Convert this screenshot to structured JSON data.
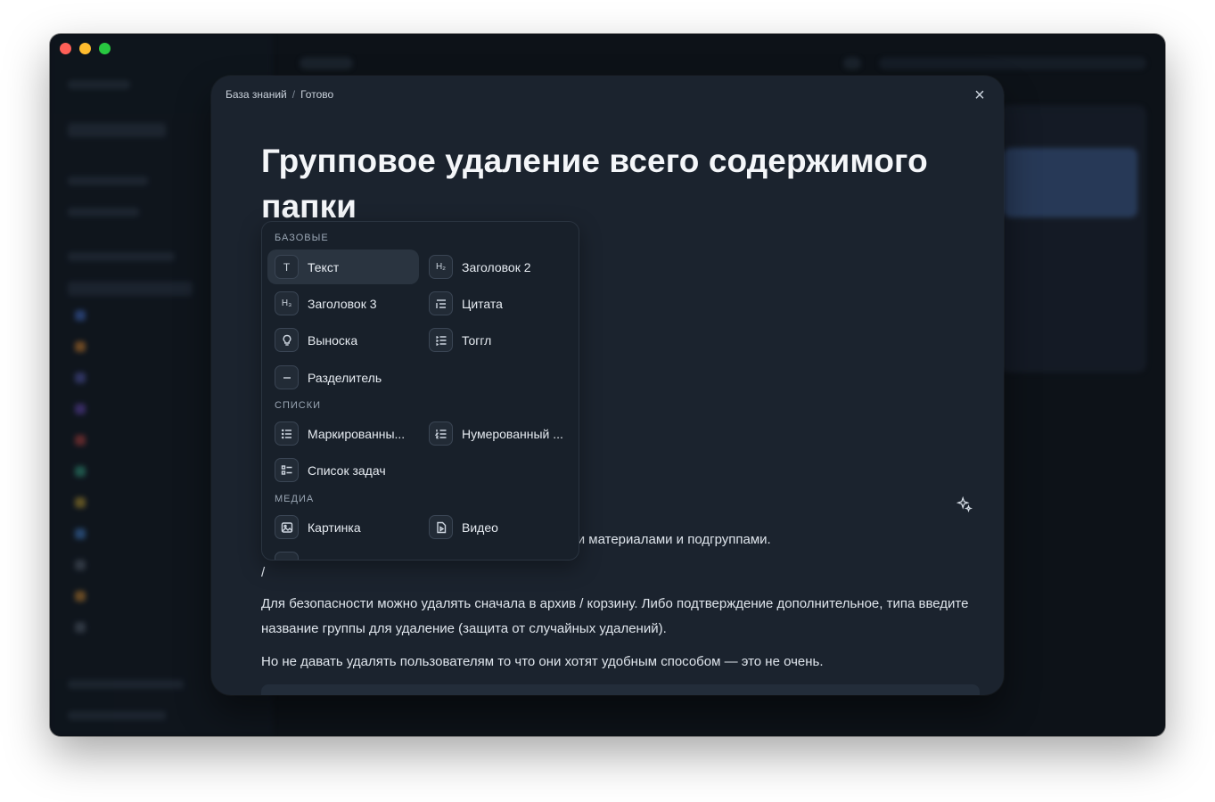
{
  "modal": {
    "breadcrumb": [
      "База знаний",
      "Готово"
    ],
    "breadcrumb_separator": "/",
    "close_label": "×",
    "title": "Групповое удаление всего содержимого папки",
    "paragraphs": {
      "partial": "ли материалами и подгруппами.",
      "slash": "/",
      "p2": "Для безопасности можно удалять сначала в архив / корзину. Либо подтверждение дополнительное, типа введите название группы для удаление (защита от случайных удалений).",
      "p3": "Но не давать удалять пользователям то что они хотят удобным способом — это не очень."
    }
  },
  "slash_menu": {
    "sections": {
      "basic": "БАЗОВЫЕ",
      "lists": "СПИСКИ",
      "media": "МЕДИА"
    },
    "items": {
      "text": {
        "label": "Текст",
        "icon": "text-icon",
        "glyph": "T"
      },
      "h2": {
        "label": "Заголовок 2",
        "icon": "heading2-icon",
        "glyph": "H₂"
      },
      "h3": {
        "label": "Заголовок 3",
        "icon": "heading3-icon",
        "glyph": "H₃"
      },
      "quote": {
        "label": "Цитата",
        "icon": "quote-icon"
      },
      "callout": {
        "label": "Выноска",
        "icon": "lightbulb-icon"
      },
      "toggle": {
        "label": "Тоггл",
        "icon": "toggle-list-icon"
      },
      "divider": {
        "label": "Разделитель",
        "icon": "divider-icon"
      },
      "bulleted": {
        "label": "Маркированны...",
        "icon": "bulleted-list-icon"
      },
      "numbered": {
        "label": "Нумерованный ...",
        "icon": "numbered-list-icon"
      },
      "todo": {
        "label": "Список задач",
        "icon": "checklist-icon"
      },
      "image": {
        "label": "Картинка",
        "icon": "image-icon"
      },
      "video": {
        "label": "Видео",
        "icon": "video-file-icon"
      }
    }
  },
  "colors": {
    "modal_bg": "#1b232e",
    "menu_bg": "#18202a",
    "active_item": "#2a3440",
    "title_text": "#f4f6f9"
  }
}
